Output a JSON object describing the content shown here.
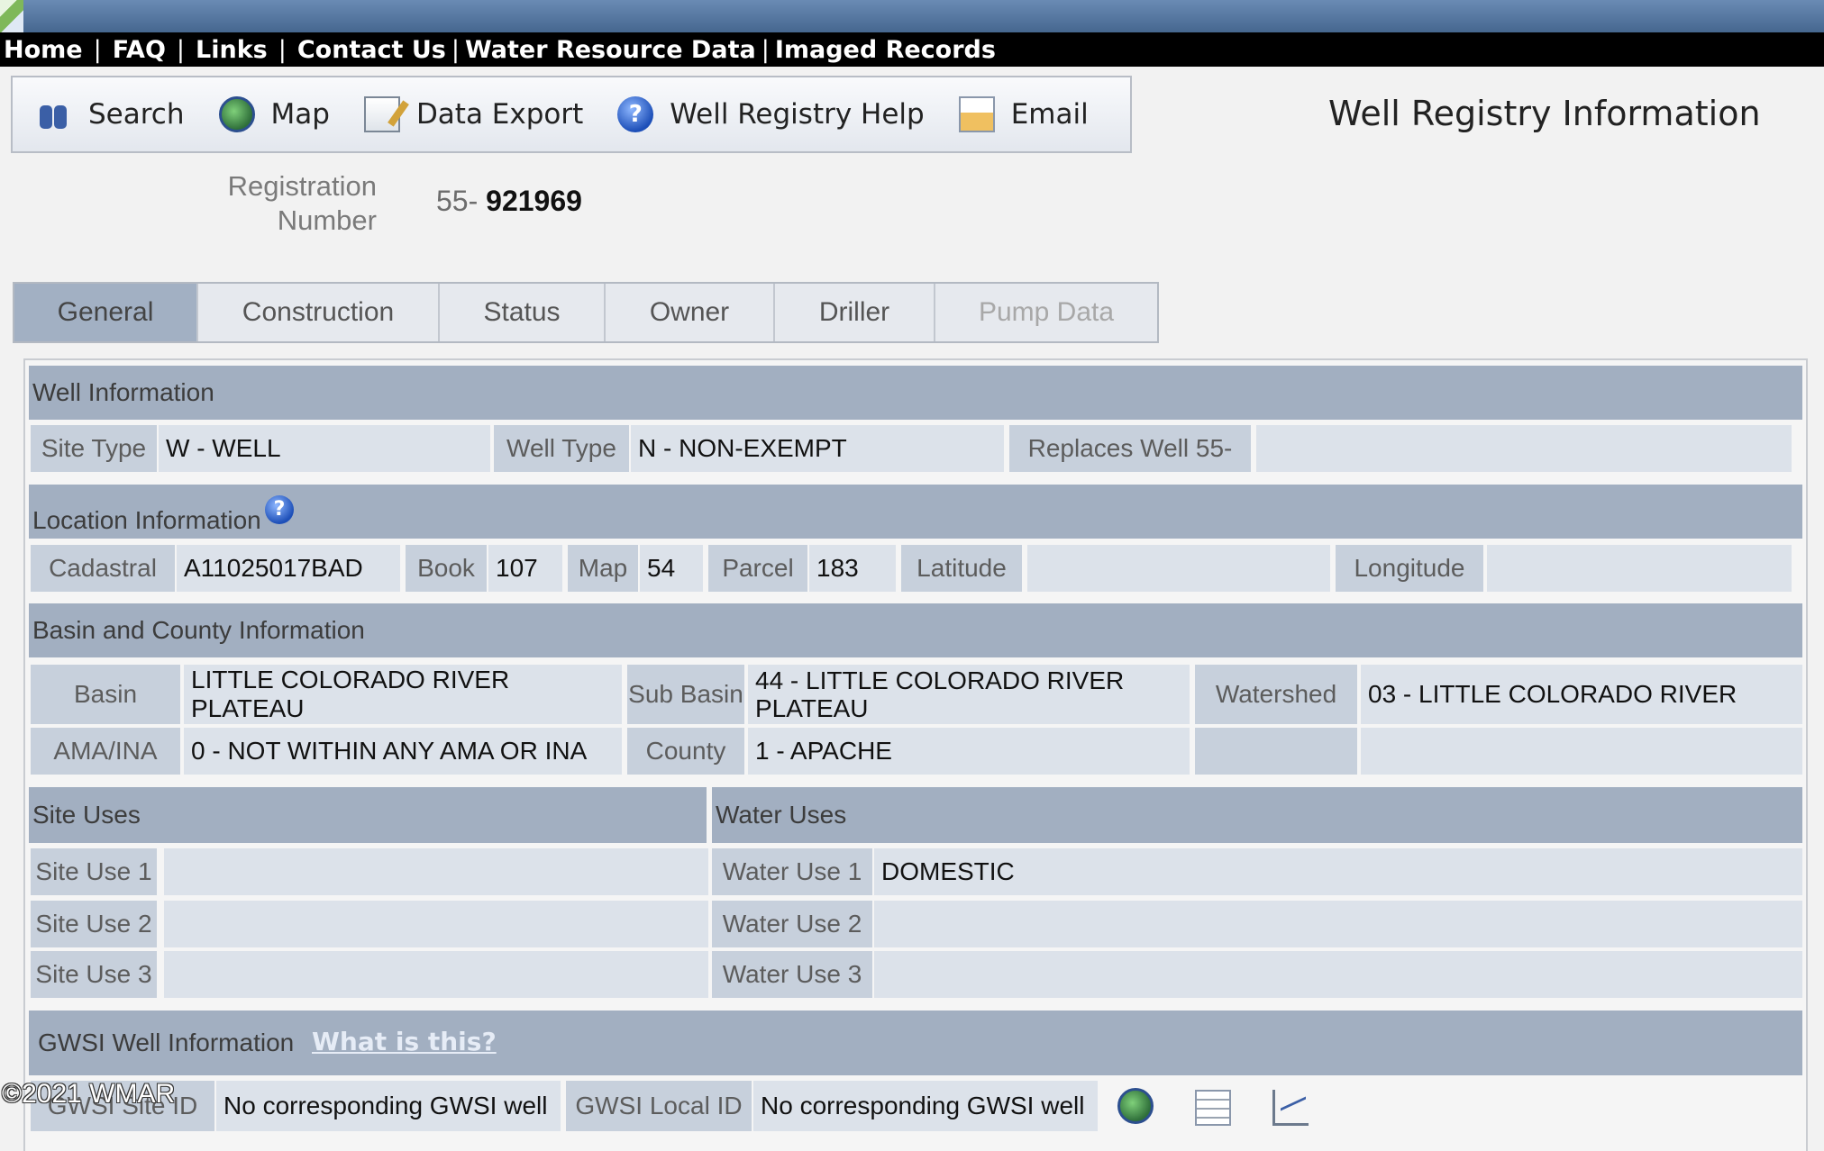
{
  "nav": {
    "items": [
      "Home",
      "FAQ",
      "Links",
      "Contact Us",
      "Water Resource Data",
      "Imaged Records"
    ]
  },
  "toolbar": {
    "search": "Search",
    "map": "Map",
    "export": "Data Export",
    "help": "Well Registry Help",
    "email": "Email"
  },
  "page_title": "Well Registry Information",
  "registration": {
    "label_line1": "Registration",
    "label_line2": "Number",
    "prefix": "55-",
    "number": "921969"
  },
  "tabs": [
    {
      "label": "General",
      "state": "active"
    },
    {
      "label": "Construction",
      "state": "normal"
    },
    {
      "label": "Status",
      "state": "normal"
    },
    {
      "label": "Owner",
      "state": "normal"
    },
    {
      "label": "Driller",
      "state": "normal"
    },
    {
      "label": "Pump Data",
      "state": "disabled"
    }
  ],
  "well_info": {
    "title": "Well Information",
    "site_type_label": "Site Type",
    "site_type": "W - WELL",
    "well_type_label": "Well Type",
    "well_type": "N - NON-EXEMPT",
    "replaces_label": "Replaces Well 55-",
    "replaces": ""
  },
  "location": {
    "title": "Location Information",
    "help_glyph": "?",
    "cadastral_label": "Cadastral",
    "cadastral": "A11025017BAD",
    "book_label": "Book",
    "book": "107",
    "map_label": "Map",
    "map": "54",
    "parcel_label": "Parcel",
    "parcel": "183",
    "latitude_label": "Latitude",
    "latitude": "",
    "longitude_label": "Longitude",
    "longitude": ""
  },
  "basin": {
    "title": "Basin and County Information",
    "basin_label": "Basin",
    "basin": "LITTLE COLORADO RIVER PLATEAU",
    "sub_basin_label": "Sub Basin",
    "sub_basin": "44 - LITTLE COLORADO RIVER PLATEAU",
    "watershed_label": "Watershed",
    "watershed": "03 - LITTLE COLORADO RIVER",
    "ama_label": "AMA/INA",
    "ama": "0 - NOT WITHIN ANY AMA OR INA",
    "county_label": "County",
    "county": "1 - APACHE"
  },
  "uses": {
    "site_title": "Site Uses",
    "water_title": "Water Uses",
    "site_use_1_label": "Site Use 1",
    "site_use_2_label": "Site Use 2",
    "site_use_3_label": "Site Use 3",
    "water_use_1_label": "Water Use 1",
    "water_use_2_label": "Water Use 2",
    "water_use_3_label": "Water Use 3",
    "water_use_1": "DOMESTIC",
    "water_use_2": "",
    "water_use_3": "",
    "site_use_1": "",
    "site_use_2": "",
    "site_use_3": ""
  },
  "gwsi": {
    "title": "GWSI Well Information",
    "what_link": "What is this?",
    "site_id_label": "GWSI Site ID",
    "site_id": "No corresponding GWSI well",
    "local_id_label": "GWSI Local ID",
    "local_id": "No corresponding GWSI well"
  },
  "watermark": "©2021 WMAR",
  "icons": {
    "search": "binoculars-icon",
    "map": "globe-map-icon",
    "export": "data-export-icon",
    "help": "help-icon",
    "email": "email-envelope-icon"
  }
}
